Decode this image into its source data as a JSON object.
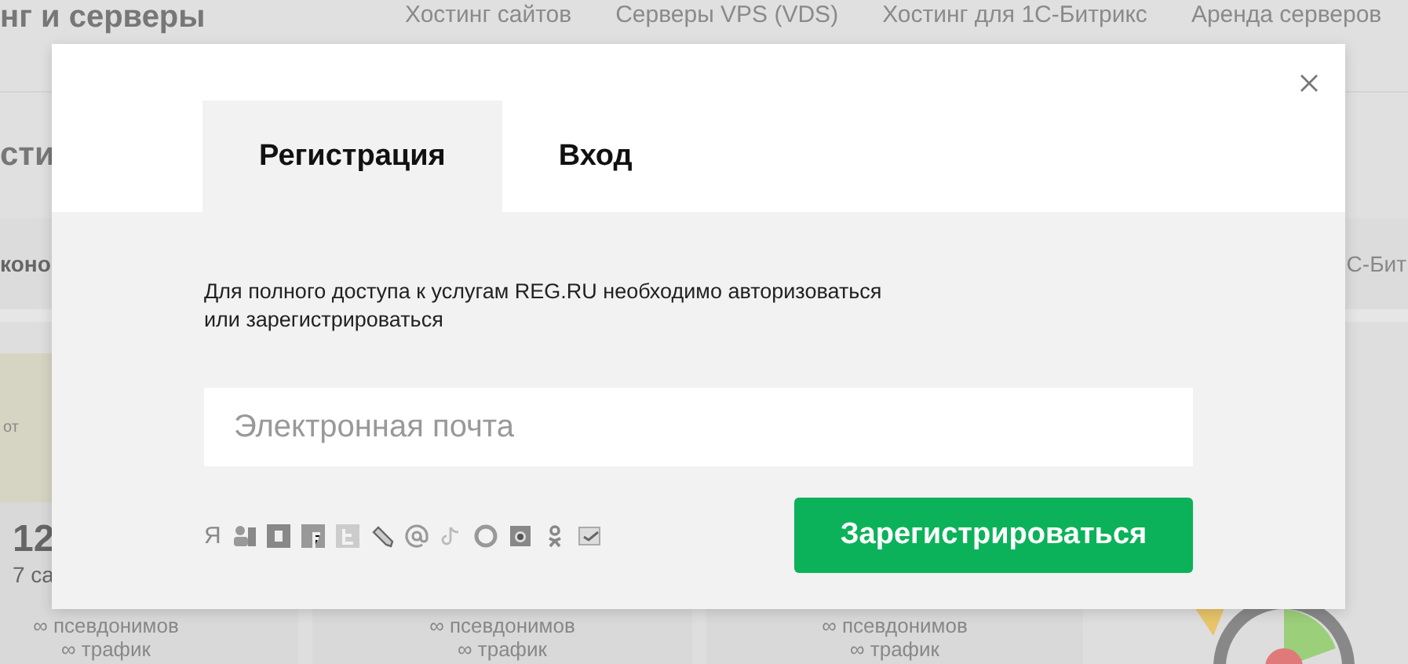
{
  "background": {
    "brand": "нг и серверы",
    "nav": [
      "Хостинг сайтов",
      "Серверы VPS (VDS)",
      "Хостинг для 1С-Битрикс",
      "Аренда серверов"
    ],
    "heading": "сти",
    "tab_left": "коно",
    "tab_right": "С-Бит",
    "cards": [
      {
        "banner": "от",
        "price": "12",
        "note": "7 са",
        "features": [
          "∞ псевдонимов",
          "∞ трафик"
        ]
      },
      {
        "features": [
          "∞ псевдонимов",
          "∞ трафик"
        ]
      },
      {
        "features": [
          "∞ псевдонимов",
          "∞ трафик"
        ]
      }
    ]
  },
  "modal": {
    "tabs": [
      {
        "label": "Регистрация",
        "selected": true
      },
      {
        "label": "Вход",
        "selected": false
      }
    ],
    "message": "Для полного доступа к услугам REG.RU необходимо авторизоваться\nили зарегистрироваться",
    "email": {
      "placeholder": "Электронная почта"
    },
    "social": [
      {
        "kind": "letter",
        "text": "Я"
      },
      {
        "kind": "gplus"
      },
      {
        "kind": "vk"
      },
      {
        "kind": "facebook"
      },
      {
        "kind": "twitter"
      },
      {
        "kind": "pencil"
      },
      {
        "kind": "at"
      },
      {
        "kind": "tiktok"
      },
      {
        "kind": "github"
      },
      {
        "kind": "camera"
      },
      {
        "kind": "ok"
      },
      {
        "kind": "check"
      }
    ],
    "submit": "Зарегистрироваться"
  }
}
